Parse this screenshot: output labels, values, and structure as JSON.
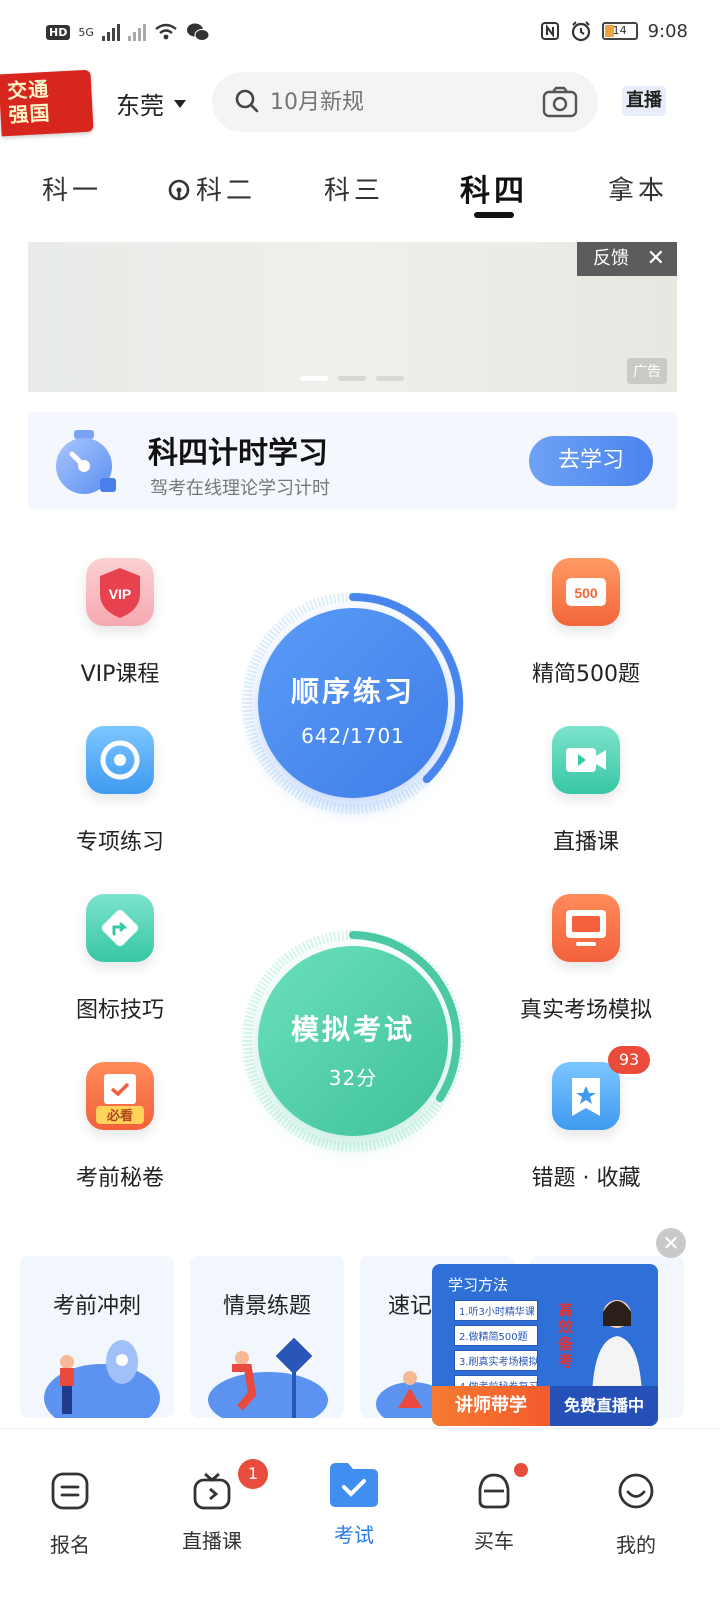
{
  "status_bar": {
    "hd": "HD",
    "net": "5G",
    "time": "9:08",
    "battery": "14"
  },
  "header": {
    "logo_text": "交通强国",
    "city": "东莞",
    "search_placeholder": "10月新规",
    "live_label": "直播"
  },
  "tabs": [
    "科一",
    "科二",
    "科三",
    "科四",
    "拿本"
  ],
  "active_tab": "科四",
  "banner": {
    "feedback": "反馈",
    "ad": "广告"
  },
  "timer": {
    "title": "科四计时学习",
    "subtitle": "驾考在线理论学习计时",
    "button": "去学习"
  },
  "features": {
    "vip": "VIP课程",
    "vip_icon_text": "VIP",
    "jingjian": "精简500题",
    "jingjian_icon_text": "500",
    "zhuanxiang": "专项练习",
    "zhibo": "直播课",
    "tubiao": "图标技巧",
    "zhenshi": "真实考场模拟",
    "mijuan": "考前秘卷",
    "mijuan_icon_text": "必看",
    "cuoti": "错题 · 收藏",
    "cuoti_badge": "93"
  },
  "practice": {
    "title": "顺序练习",
    "progress": "642/1701",
    "done": 642,
    "total": 1701
  },
  "exam": {
    "title": "模拟考试",
    "score": "32分"
  },
  "cards": [
    "考前冲刺",
    "情景练题",
    "速记"
  ],
  "float_ad": {
    "title": "学习方法",
    "items": [
      "1.听3小时精华课",
      "2.做精简500题",
      "3.刷真实考场模拟",
      "4.做考前秘卷复习"
    ],
    "side": "高效备考",
    "left": "讲师带学",
    "right": "免费直播中"
  },
  "nav": [
    {
      "label": "报名"
    },
    {
      "label": "直播课",
      "badge": "1"
    },
    {
      "label": "考试"
    },
    {
      "label": "买车"
    },
    {
      "label": "我的"
    }
  ],
  "colors": {
    "accent": "#2c7be5",
    "practice_blue": "#4a86ee",
    "exam_green": "#4cc9a4",
    "badge_red": "#e74c3c"
  }
}
